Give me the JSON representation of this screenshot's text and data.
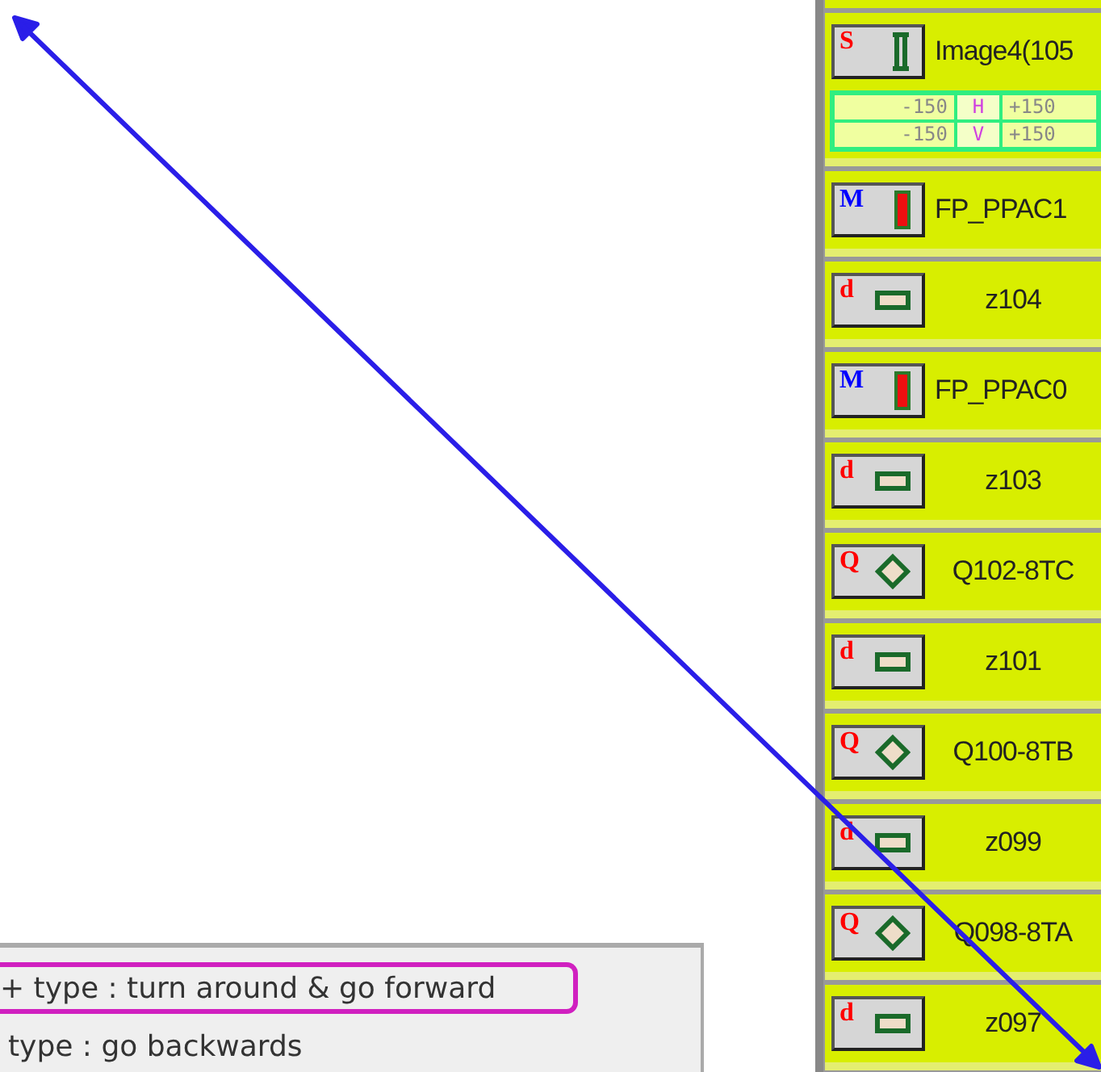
{
  "element_list": [
    {
      "kind": "sample",
      "badge": "S",
      "color": "#ff0000",
      "label": "Image4(105",
      "ranges": [
        {
          "min": "-150",
          "axis": "H",
          "max": "+150"
        },
        {
          "min": "-150",
          "axis": "V",
          "max": "+150"
        }
      ]
    },
    {
      "kind": "monitor",
      "badge": "M",
      "color": "#0000ff",
      "label": "FP_PPAC1"
    },
    {
      "kind": "drift",
      "badge": "d",
      "color": "#ff0000",
      "label": "z104"
    },
    {
      "kind": "monitor",
      "badge": "M",
      "color": "#0000ff",
      "label": "FP_PPAC0"
    },
    {
      "kind": "drift",
      "badge": "d",
      "color": "#ff0000",
      "label": "z103"
    },
    {
      "kind": "quad",
      "badge": "Q",
      "color": "#ff0000",
      "label": "Q102-8TC"
    },
    {
      "kind": "drift",
      "badge": "d",
      "color": "#ff0000",
      "label": "z101"
    },
    {
      "kind": "quad",
      "badge": "Q",
      "color": "#ff0000",
      "label": "Q100-8TB"
    },
    {
      "kind": "drift",
      "badge": "d",
      "color": "#ff0000",
      "label": "z099"
    },
    {
      "kind": "quad",
      "badge": "Q",
      "color": "#ff0000",
      "label": "Q098-8TA"
    },
    {
      "kind": "drift",
      "badge": "d",
      "color": "#ff0000",
      "label": "z097"
    }
  ],
  "legend": [
    {
      "text": "+ type : turn around & go forward",
      "highlighted": true
    },
    {
      "text": "type : go backwards",
      "highlighted": false
    }
  ]
}
